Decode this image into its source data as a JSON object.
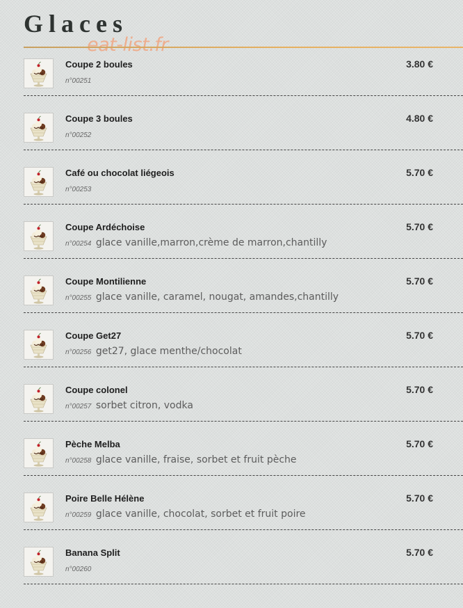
{
  "page": {
    "title": "Glaces",
    "watermark": "eat-list.fr"
  },
  "colors": {
    "accent_rule": "#e6b060",
    "watermark": "#f0a682",
    "background": "#dde0df"
  },
  "items": [
    {
      "name": "Coupe 2 boules",
      "ref": "n°00251",
      "desc": "",
      "price": "3.80 €",
      "icon": "ice-cream-sundae-icon"
    },
    {
      "name": "Coupe 3 boules",
      "ref": "n°00252",
      "desc": "",
      "price": "4.80 €",
      "icon": "ice-cream-sundae-icon"
    },
    {
      "name": "Café ou chocolat liégeois",
      "ref": "n°00253",
      "desc": "",
      "price": "5.70 €",
      "icon": "ice-cream-sundae-icon"
    },
    {
      "name": "Coupe Ardéchoise",
      "ref": "n°00254",
      "desc": "glace vanille,marron,crème de marron,chantilly",
      "price": "5.70 €",
      "icon": "ice-cream-sundae-icon"
    },
    {
      "name": "Coupe Montilienne",
      "ref": "n°00255",
      "desc": "glace vanille, caramel, nougat, amandes,chantilly",
      "price": "5.70 €",
      "icon": "ice-cream-sundae-icon"
    },
    {
      "name": "Coupe Get27",
      "ref": "n°00256",
      "desc": "get27, glace menthe/chocolat",
      "price": "5.70 €",
      "icon": "ice-cream-sundae-icon"
    },
    {
      "name": "Coupe colonel",
      "ref": "n°00257",
      "desc": "sorbet citron, vodka",
      "price": "5.70 €",
      "icon": "ice-cream-sundae-icon"
    },
    {
      "name": "Pèche Melba",
      "ref": "n°00258",
      "desc": "glace vanille, fraise, sorbet et fruit pèche",
      "price": "5.70 €",
      "icon": "ice-cream-sundae-icon"
    },
    {
      "name": "Poire Belle Hélène",
      "ref": "n°00259",
      "desc": "glace vanille, chocolat, sorbet et fruit poire",
      "price": "5.70 €",
      "icon": "ice-cream-sundae-icon"
    },
    {
      "name": "Banana Split",
      "ref": "n°00260",
      "desc": "",
      "price": "5.70 €",
      "icon": "ice-cream-sundae-icon"
    }
  ]
}
